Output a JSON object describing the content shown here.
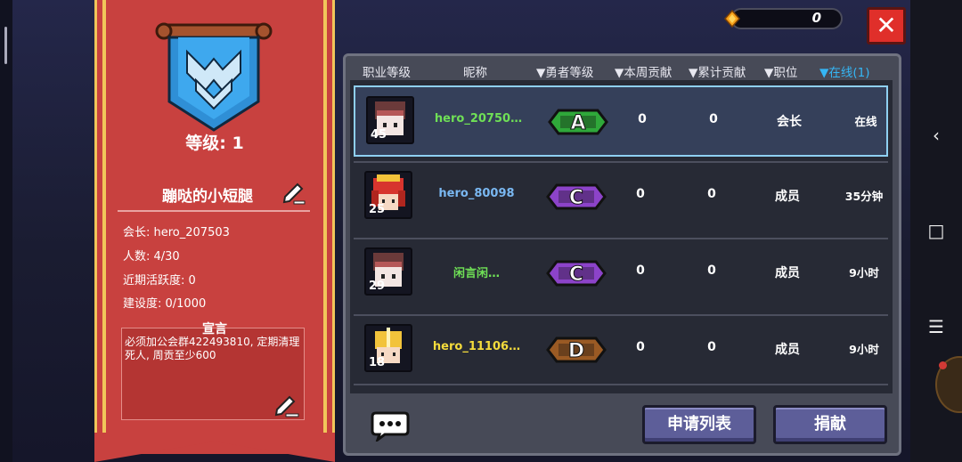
{
  "currency": {
    "amount": "0"
  },
  "guild": {
    "level": "等级: 1",
    "name": "蹦哒的小短腿",
    "leader": "会长: hero_207503",
    "members": "人数: 4/30",
    "activity": "近期活跃度: 0",
    "construction": "建设度: 0/1000",
    "declaration_title": "宣言",
    "declaration_text": "必须加公会群422493810, 定期清理死人, 周贡至少600"
  },
  "table": {
    "headers": [
      {
        "label": "职业等级",
        "sortable": false,
        "active": false
      },
      {
        "label": "昵称",
        "sortable": false,
        "active": false
      },
      {
        "label": "勇者等级",
        "sortable": true,
        "active": false
      },
      {
        "label": "本周贡献",
        "sortable": true,
        "active": false
      },
      {
        "label": "累计贡献",
        "sortable": true,
        "active": false
      },
      {
        "label": "职位",
        "sortable": true,
        "active": false
      },
      {
        "label": "在线(1)",
        "sortable": true,
        "active": true
      }
    ],
    "rows": [
      {
        "level": "45",
        "nickname": "hero_20750…",
        "nick_color": "#6fe056",
        "rank": "A",
        "rank_color": "#2fa83a",
        "weekly": "0",
        "total": "0",
        "position": "会长",
        "online": "在线",
        "selected": true,
        "avatar": "knight-hooded"
      },
      {
        "level": "25",
        "nickname": "hero_80098",
        "nick_color": "#7ab8f2",
        "rank": "C",
        "rank_color": "#8c43c9",
        "weekly": "0",
        "total": "0",
        "position": "成员",
        "online": "35分钟",
        "selected": false,
        "avatar": "red-helmet"
      },
      {
        "level": "29",
        "nickname": "闲言闲…",
        "nick_color": "#6fe056",
        "rank": "C",
        "rank_color": "#8c43c9",
        "weekly": "0",
        "total": "0",
        "position": "成员",
        "online": "9小时",
        "selected": false,
        "avatar": "knight-hooded"
      },
      {
        "level": "18",
        "nickname": "hero_11106…",
        "nick_color": "#f5dc3c",
        "rank": "D",
        "rank_color": "#9a5a24",
        "weekly": "0",
        "total": "0",
        "position": "成员",
        "online": "9小时",
        "selected": false,
        "avatar": "gold-helmet"
      }
    ]
  },
  "buttons": {
    "apply_list": "申请列表",
    "donate": "捐献"
  },
  "colors": {
    "banner": "#c8413f",
    "trim": "#f1c65a",
    "accent": "#35b6f5",
    "close": "#e02f2a"
  },
  "icons": [
    "coin-icon",
    "close-icon",
    "guild-emblem",
    "edit-icon",
    "chat-icon",
    "back-icon",
    "home-icon",
    "menu-icon"
  ]
}
